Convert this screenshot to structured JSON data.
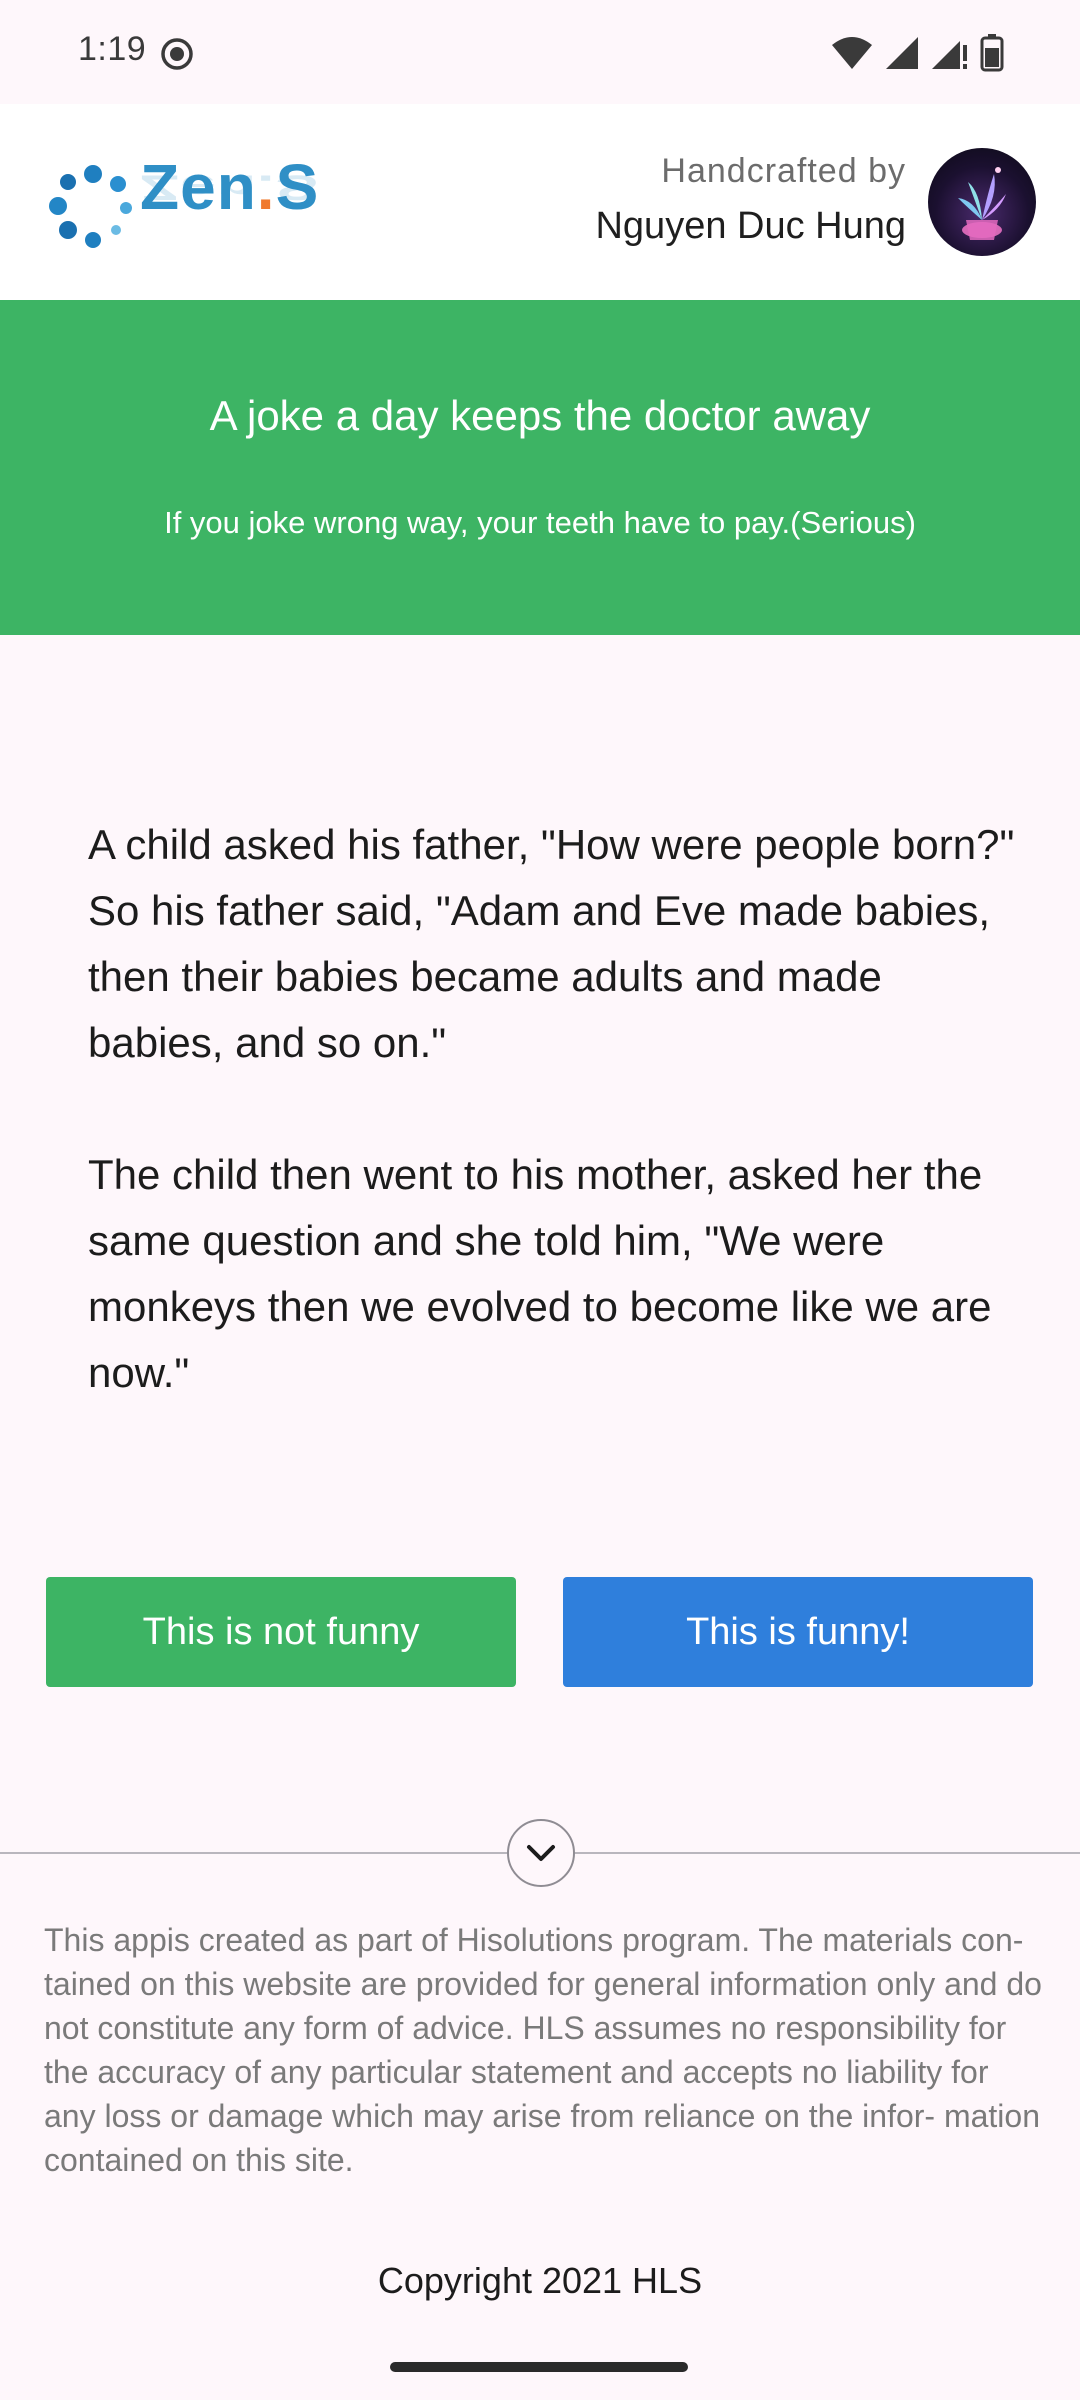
{
  "status_bar": {
    "time": "1:19",
    "icons": [
      "record-icon",
      "wifi-icon",
      "signal-icon",
      "signal-icon-2",
      "battery-icon"
    ]
  },
  "header": {
    "logo_text": "Zen",
    "logo_dot": ".",
    "logo_suffix": "S",
    "byline_small": "Handcrafted by",
    "byline_name": "Nguyen Duc Hung"
  },
  "banner": {
    "title": "A joke a day keeps the doctor away",
    "subtitle": "If you joke wrong way, your teeth have to pay.(Serious)"
  },
  "joke": {
    "paragraphs": [
      "A child asked his father, \"How were people born?\" So his father said, \"Adam and Eve made babies, then their babies became adults and made babies, and so on.\"",
      "The child then went to his mother, asked her the same question and she told him, \"We were monkeys then we evolved to become like we are now.\""
    ]
  },
  "buttons": {
    "not_funny_label": "This is not funny",
    "funny_label": "This is funny!"
  },
  "footer": {
    "disclaimer": "This appis created as part of Hisolutions program. The materials con- tained on this website are provided for general information only and do not constitute any form of advice. HLS assumes no responsibility for the accuracy of any particular statement and accepts no liability for any loss or damage which may arise from reliance on the infor- mation contained on this site.",
    "copyright": "Copyright 2021 HLS"
  },
  "colors": {
    "green": "#3db464",
    "blue": "#2f7fdc",
    "logo_blue": "#2f8fc6",
    "logo_orange": "#f07a2e"
  }
}
